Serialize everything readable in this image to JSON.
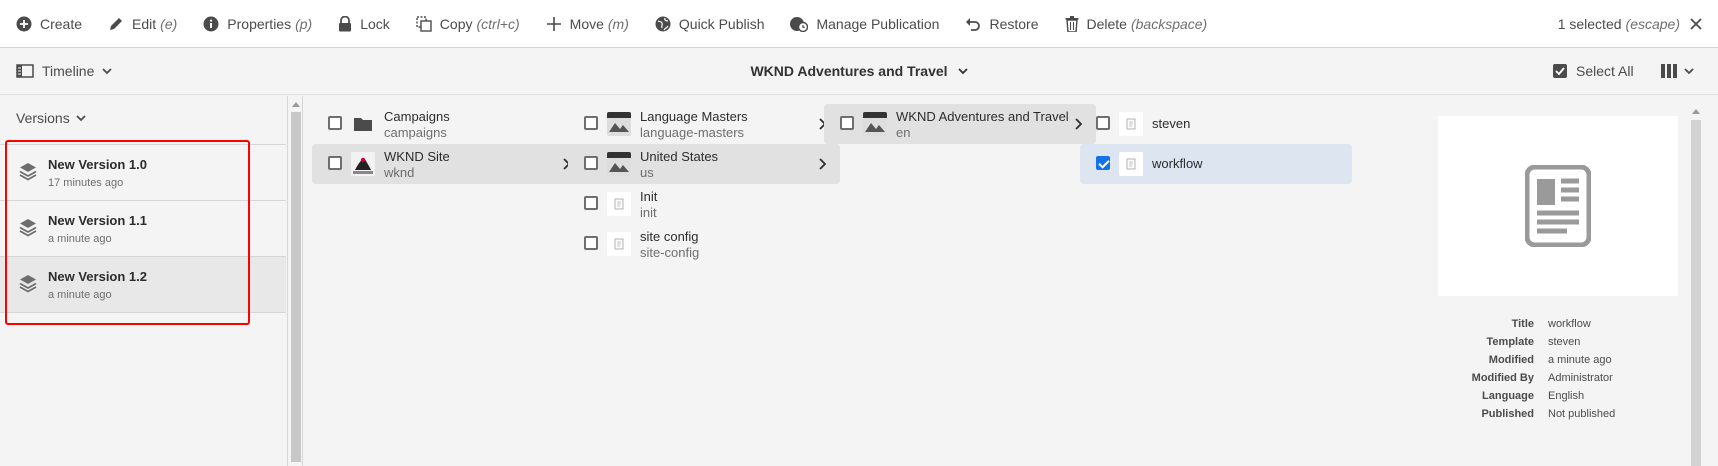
{
  "actionbar": {
    "create": "Create",
    "edit": "Edit",
    "edit_key": "(e)",
    "properties": "Properties",
    "properties_key": "(p)",
    "lock": "Lock",
    "copy": "Copy",
    "copy_key": "(ctrl+c)",
    "move": "Move",
    "move_key": "(m)",
    "quick_publish": "Quick Publish",
    "manage_publication": "Manage Publication",
    "restore": "Restore",
    "delete": "Delete",
    "delete_key": "(backspace)",
    "selected": "1 selected",
    "selected_key": "(escape)"
  },
  "titlebar": {
    "rail_mode": "Timeline",
    "title": "WKND Adventures and Travel",
    "select_all": "Select All"
  },
  "rail": {
    "header": "Versions",
    "versions": [
      {
        "name": "New Version 1.0",
        "time": "17 minutes ago"
      },
      {
        "name": "New Version 1.1",
        "time": "a minute ago"
      },
      {
        "name": "New Version 1.2",
        "time": "a minute ago"
      }
    ]
  },
  "columns": [
    {
      "items": [
        {
          "title": "Campaigns",
          "subtitle": "campaigns"
        },
        {
          "title": "WKND Site",
          "subtitle": "wknd"
        }
      ]
    },
    {
      "items": [
        {
          "title": "Language Masters",
          "subtitle": "language-masters"
        },
        {
          "title": "United States",
          "subtitle": "us"
        },
        {
          "title": "Init",
          "subtitle": "init"
        },
        {
          "title": "site config",
          "subtitle": "site-config"
        }
      ]
    },
    {
      "items": [
        {
          "title": "WKND Adventures and Travel",
          "subtitle": "en"
        }
      ]
    },
    {
      "items": [
        {
          "title": "steven"
        },
        {
          "title": "workflow"
        }
      ]
    }
  ],
  "meta": {
    "title_label": "Title",
    "title_value": "workflow",
    "template_label": "Template",
    "template_value": "steven",
    "modified_label": "Modified",
    "modified_value": "a minute ago",
    "modified_by_label": "Modified By",
    "modified_by_value": "Administrator",
    "language_label": "Language",
    "language_value": "English",
    "published_label": "Published",
    "published_value": "Not published"
  },
  "colors": {
    "accent": "#1473e6",
    "highlight_box": "#ff0000",
    "selected_row": "#dde6f0"
  }
}
